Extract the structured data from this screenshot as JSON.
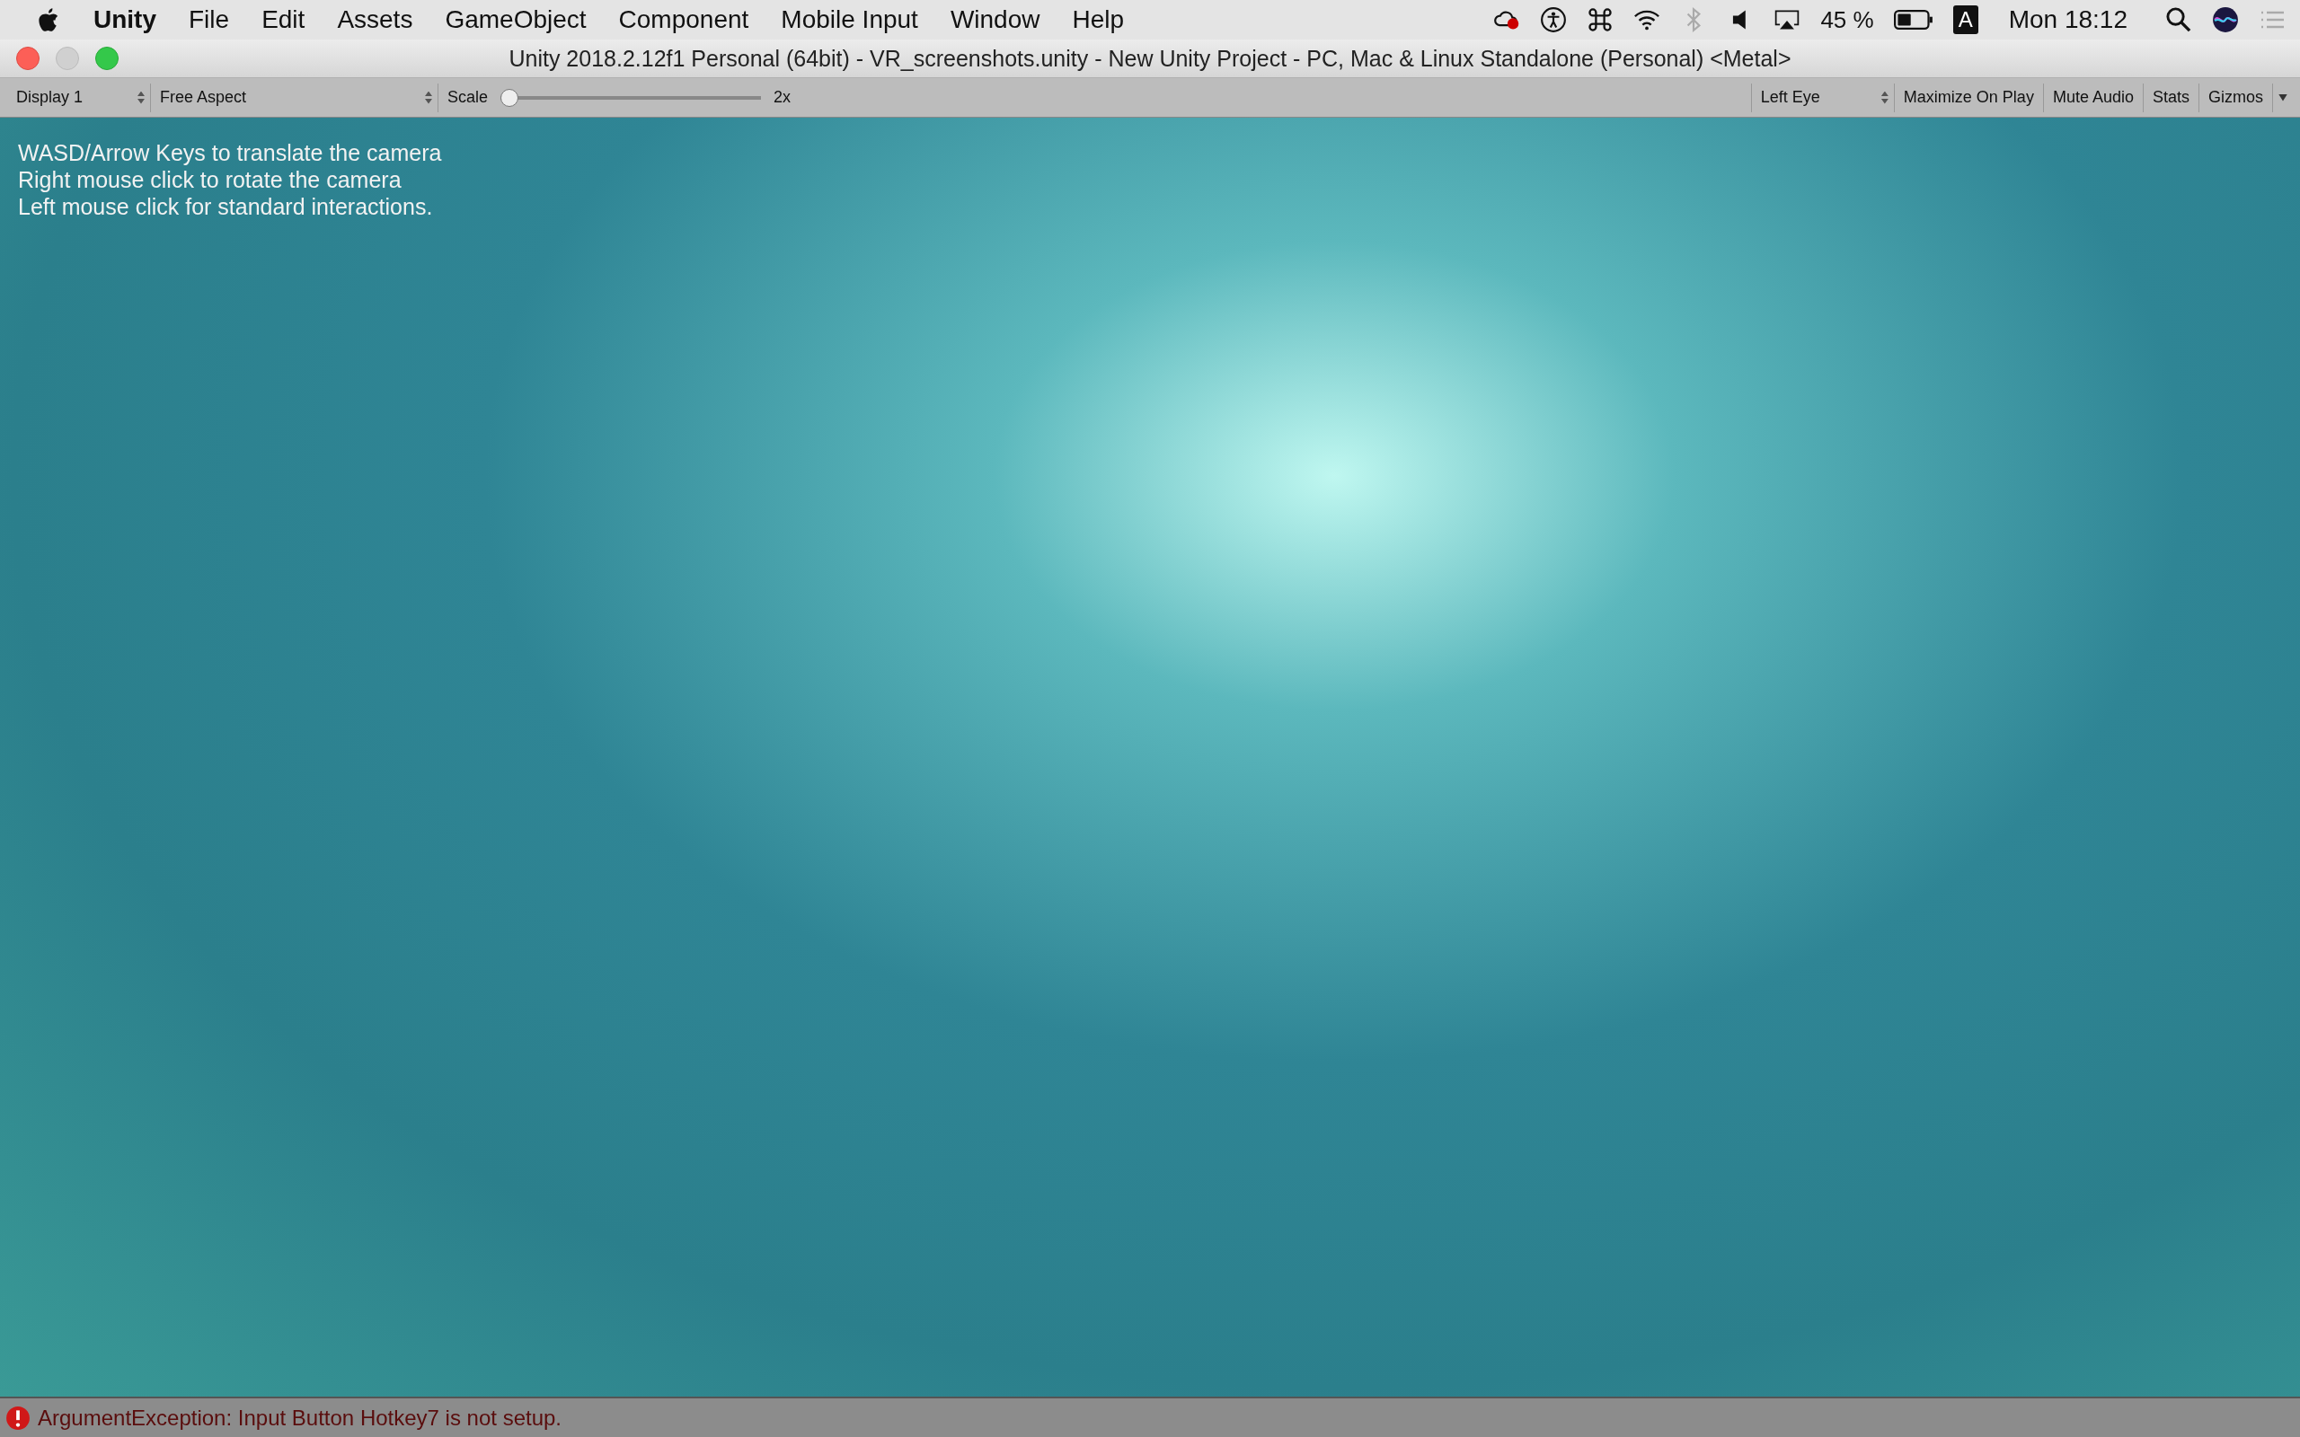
{
  "menu_bar": {
    "app_name": "Unity",
    "menus": [
      "File",
      "Edit",
      "Assets",
      "GameObject",
      "Component",
      "Mobile Input",
      "Window",
      "Help"
    ],
    "battery": "45 %",
    "input_source": "A",
    "clock": "Mon 18:12"
  },
  "window": {
    "title": "Unity 2018.2.12f1 Personal (64bit) - VR_screenshots.unity - New Unity Project - PC, Mac & Linux Standalone (Personal) <Metal>"
  },
  "toolbar": {
    "display": "Display 1",
    "aspect": "Free Aspect",
    "scale": {
      "label": "Scale",
      "level": 0,
      "reading": "2x"
    },
    "eye": "Left Eye",
    "buttons": [
      {
        "label": "Maximize On Play",
        "on": false
      },
      {
        "label": "Mute Audio",
        "on": false
      },
      {
        "label": "Stats",
        "on": false
      },
      {
        "label": "Gizmos",
        "on": false
      }
    ]
  },
  "game_view": {
    "instructions": [
      "WASD/Arrow Keys to translate the camera",
      "Right mouse click to rotate the camera",
      "Left mouse click for standard interactions."
    ]
  },
  "status_bar": {
    "message": "ArgumentException: Input Button Hotkey7 is not setup.",
    "kind": "error"
  }
}
